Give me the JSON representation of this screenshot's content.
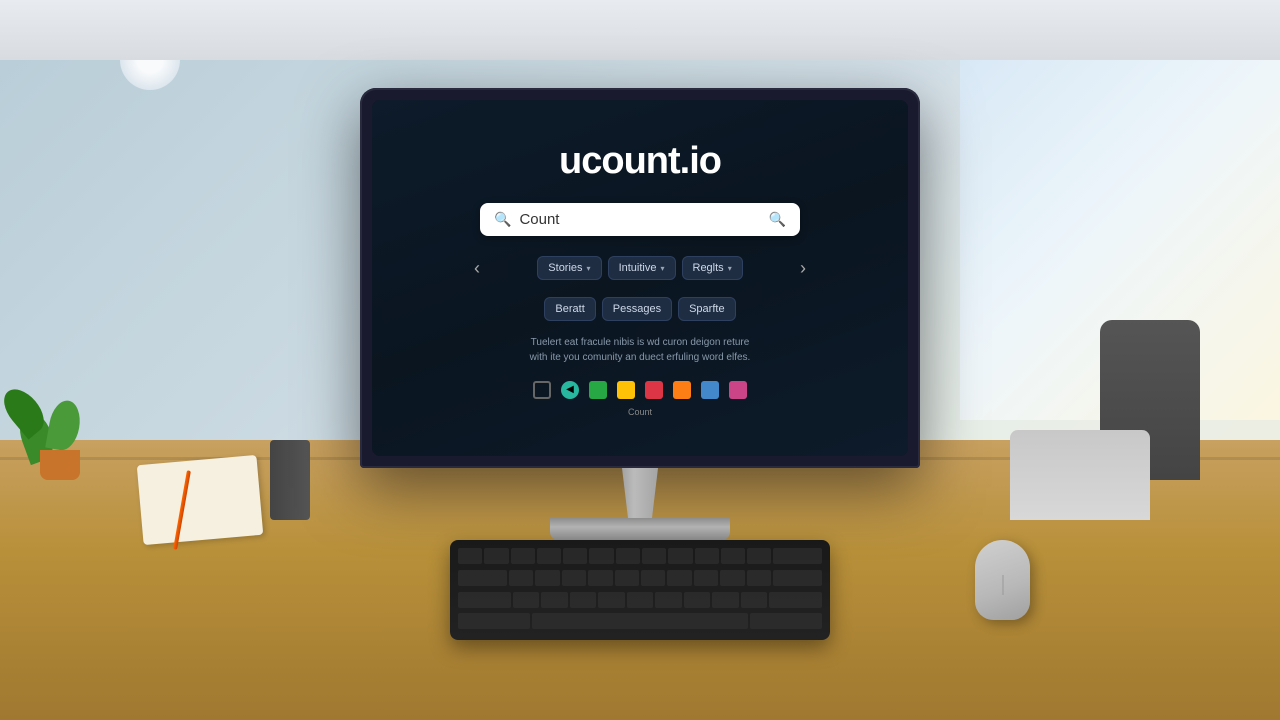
{
  "app": {
    "logo": "ucount.io",
    "logo_dot": ".",
    "logo_prefix": "ucount"
  },
  "search": {
    "placeholder": "Count",
    "value": "Count",
    "icon_left": "🔍",
    "icon_right": "🔍"
  },
  "filters": {
    "nav_left": "‹",
    "nav_right": "›",
    "tags_row1": [
      {
        "label": "Stories",
        "has_dropdown": true
      },
      {
        "label": "Intuitive",
        "has_dropdown": true
      },
      {
        "label": "Reglts",
        "has_dropdown": true
      }
    ],
    "tags_row2": [
      {
        "label": "Beratt",
        "has_dropdown": false
      },
      {
        "label": "Pessages",
        "has_dropdown": false
      },
      {
        "label": "Sparfte",
        "has_dropdown": false
      }
    ]
  },
  "description": {
    "line1": "Tuelert eat fracule nibis is wd curon deigon reture",
    "line2": "with ite you comunity an duect erfuling word elfes."
  },
  "bottom_icons": [
    {
      "type": "outline",
      "label": ""
    },
    {
      "type": "nav",
      "color": "#28b8a0",
      "label": ""
    },
    {
      "type": "green",
      "color": "#28a745",
      "label": ""
    },
    {
      "type": "yellow",
      "color": "#ffc107",
      "label": ""
    },
    {
      "type": "red",
      "color": "#dc3545",
      "label": ""
    },
    {
      "type": "orange",
      "color": "#fd7e14",
      "label": ""
    },
    {
      "type": "blue",
      "color": "#4488cc",
      "label": ""
    },
    {
      "type": "dark",
      "color": "#cc4488",
      "label": ""
    }
  ],
  "taskbar_label": "Count"
}
